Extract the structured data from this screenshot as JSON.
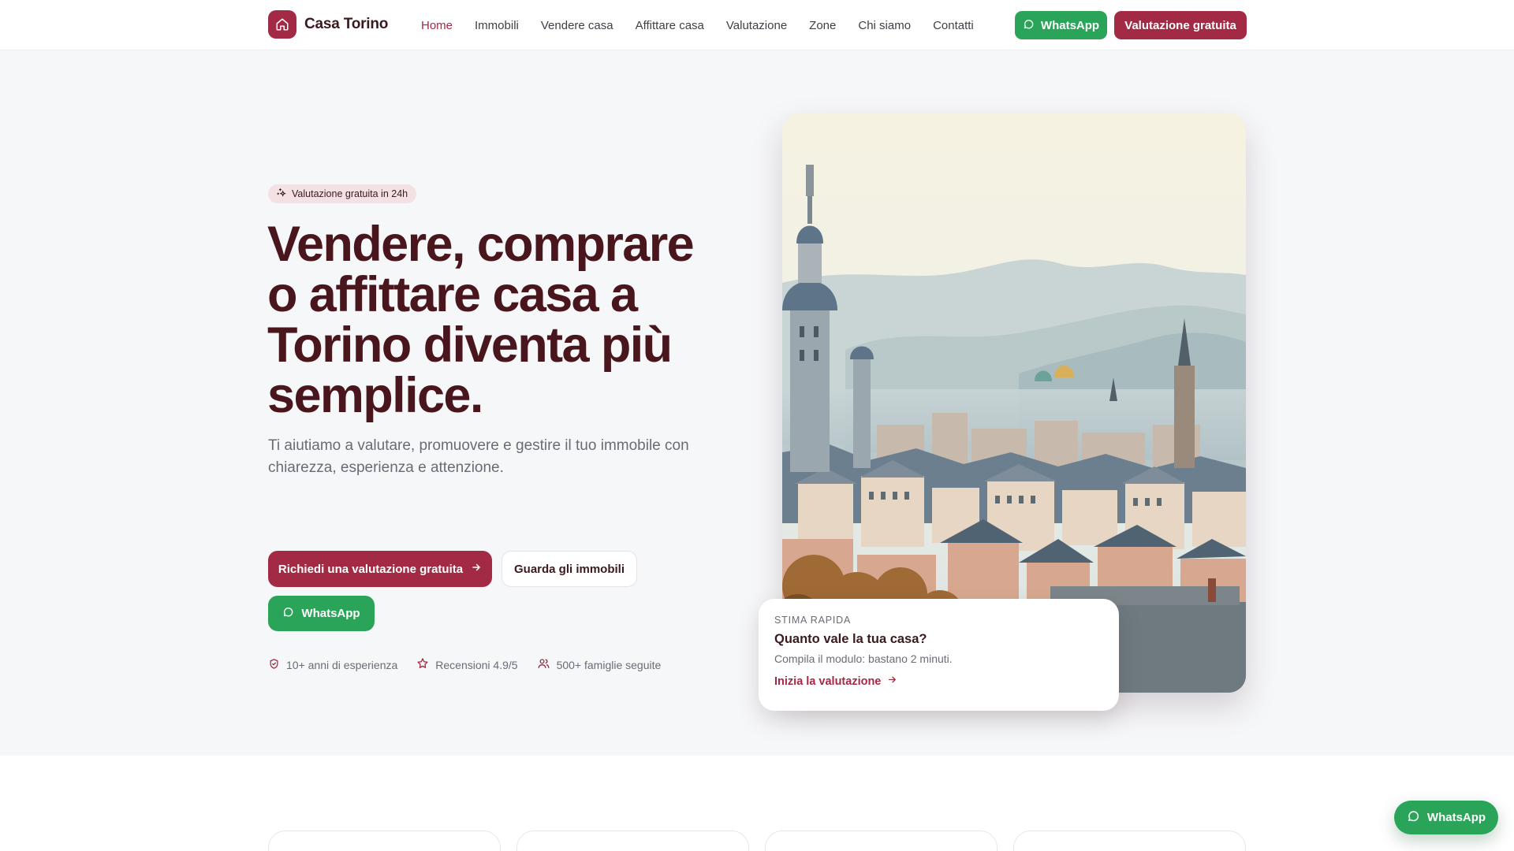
{
  "brand": {
    "name": "Casa Torino",
    "icon": "home-icon",
    "accent": "#a32a44",
    "whatsapp_green": "#2aa459"
  },
  "nav": {
    "items": [
      {
        "label": "Home",
        "active": true
      },
      {
        "label": "Immobili"
      },
      {
        "label": "Vendere casa"
      },
      {
        "label": "Affittare casa"
      },
      {
        "label": "Valutazione"
      },
      {
        "label": "Zone"
      },
      {
        "label": "Chi siamo"
      },
      {
        "label": "Contatti"
      }
    ],
    "whatsapp_label": "WhatsApp",
    "cta_label": "Valutazione gratuita"
  },
  "hero": {
    "chip": "Valutazione gratuita in 24h",
    "title": "Vendere, comprare o affittare casa a Torino diventa più semplice.",
    "subtitle": "Ti aiutiamo a valutare, promuovere e gestire il tuo immobile con chiarezza, esperienza e attenzione.",
    "primary_cta": "Richiedi una valutazione gratuita",
    "secondary_cta": "Guarda gli immobili",
    "whatsapp_cta": "WhatsApp",
    "stats": [
      {
        "icon": "shield-icon",
        "label": "10+ anni di esperienza"
      },
      {
        "icon": "star-icon",
        "label": "Recensioni 4.9/5"
      },
      {
        "icon": "users-icon",
        "label": "500+ famiglie seguite"
      }
    ]
  },
  "stima": {
    "kicker": "STIMA RAPIDA",
    "title": "Quanto vale la tua casa?",
    "text": "Compila il modulo: bastano 2 minuti.",
    "link": "Inizia la valutazione"
  },
  "floating": {
    "whatsapp_label": "WhatsApp"
  }
}
